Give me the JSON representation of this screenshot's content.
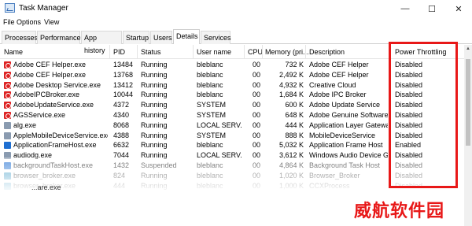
{
  "window": {
    "title": "Task Manager",
    "minimize": "—",
    "maximize": "☐",
    "close": "✕"
  },
  "menu": [
    "File",
    "Options",
    "View"
  ],
  "tabs": [
    "Processes",
    "Performance",
    "App history",
    "Startup",
    "Users",
    "Details",
    "Services"
  ],
  "active_tab": "Details",
  "columns": [
    "Name",
    "PID",
    "Status",
    "User name",
    "CPU",
    "Memory (pri...",
    "Description",
    "Power Throttling"
  ],
  "rows": [
    {
      "name": "Adobe CEF Helper.exe",
      "pid": "13484",
      "status": "Running",
      "user": "bleblanc",
      "cpu": "00",
      "memory": "732 K",
      "description": "Adobe CEF Helper",
      "power": "Disabled",
      "icon": "cef"
    },
    {
      "name": "Adobe CEF Helper.exe",
      "pid": "13768",
      "status": "Running",
      "user": "bleblanc",
      "cpu": "00",
      "memory": "2,492 K",
      "description": "Adobe CEF Helper",
      "power": "Disabled",
      "icon": "cef"
    },
    {
      "name": "Adobe Desktop Service.exe",
      "pid": "13412",
      "status": "Running",
      "user": "bleblanc",
      "cpu": "00",
      "memory": "4,932 K",
      "description": "Creative Cloud",
      "power": "Disabled",
      "icon": "cef"
    },
    {
      "name": "AdobeIPCBroker.exe",
      "pid": "10044",
      "status": "Running",
      "user": "bleblanc",
      "cpu": "00",
      "memory": "1,684 K",
      "description": "Adobe IPC Broker",
      "power": "Disabled",
      "icon": "cef"
    },
    {
      "name": "AdobeUpdateService.exe",
      "pid": "4372",
      "status": "Running",
      "user": "SYSTEM",
      "cpu": "00",
      "memory": "600 K",
      "description": "Adobe Update Service",
      "power": "Disabled",
      "icon": "cef"
    },
    {
      "name": "AGSService.exe",
      "pid": "4340",
      "status": "Running",
      "user": "SYSTEM",
      "cpu": "00",
      "memory": "648 K",
      "description": "Adobe Genuine Software ...",
      "power": "Disabled",
      "icon": "cef"
    },
    {
      "name": "alg.exe",
      "pid": "8068",
      "status": "Running",
      "user": "LOCAL SERV...",
      "cpu": "00",
      "memory": "444 K",
      "description": "Application Layer Gatewa...",
      "power": "Disabled",
      "icon": "gray"
    },
    {
      "name": "AppleMobileDeviceService.exe",
      "pid": "4388",
      "status": "Running",
      "user": "SYSTEM",
      "cpu": "00",
      "memory": "888 K",
      "description": "MobileDeviceService",
      "power": "Disabled",
      "icon": "gray"
    },
    {
      "name": "ApplicationFrameHost.exe",
      "pid": "6632",
      "status": "Running",
      "user": "bleblanc",
      "cpu": "00",
      "memory": "5,032 K",
      "description": "Application Frame Host",
      "power": "Enabled",
      "icon": "blue"
    },
    {
      "name": "audiodg.exe",
      "pid": "7044",
      "status": "Running",
      "user": "LOCAL SERV...",
      "cpu": "00",
      "memory": "3,612 K",
      "description": "Windows Audio Device Gr...",
      "power": "Disabled",
      "icon": "gray"
    },
    {
      "name": "backgroundTaskHost.exe",
      "pid": "1432",
      "status": "Suspended",
      "user": "bleblanc",
      "cpu": "00",
      "memory": "4,864 K",
      "description": "Background Task Host",
      "power": "Disabled",
      "icon": "blue"
    },
    {
      "name": "browser_broker.exe",
      "pid": "824",
      "status": "Running",
      "user": "bleblanc",
      "cpu": "00",
      "memory": "1,020 K",
      "description": "Browser_Broker",
      "power": "Disabled",
      "icon": "teal"
    },
    {
      "name": "browser_broker.exe",
      "pid": "444",
      "status": "Running",
      "user": "bleblanc",
      "cpu": "00",
      "memory": "1,000 K",
      "description": "CCXProcess",
      "power": "Disabled",
      "icon": "teal"
    }
  ],
  "trailing_fragment": "...are.exe",
  "watermark": "威航软件园"
}
